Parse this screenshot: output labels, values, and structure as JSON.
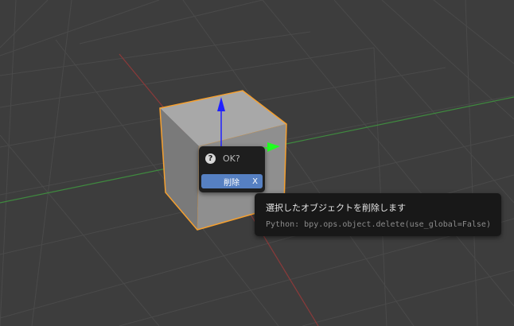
{
  "viewport": {
    "background_color": "#3d3d3d",
    "grid_color": "#4a4a4a",
    "x_axis_color": "#8a3a3a",
    "y_axis_color": "#3f8a3f",
    "selection_outline_color": "#f5a030",
    "gizmo_z_color": "#2020ff",
    "gizmo_y_color": "#20ff20"
  },
  "confirm_popup": {
    "icon": "question-icon",
    "title": "OK?",
    "delete_label": "削除",
    "delete_shortcut": "X",
    "button_color": "#5680c2"
  },
  "tooltip": {
    "description": "選択したオブジェクトを削除します",
    "python": "Python: bpy.ops.object.delete(use_global=False)"
  }
}
